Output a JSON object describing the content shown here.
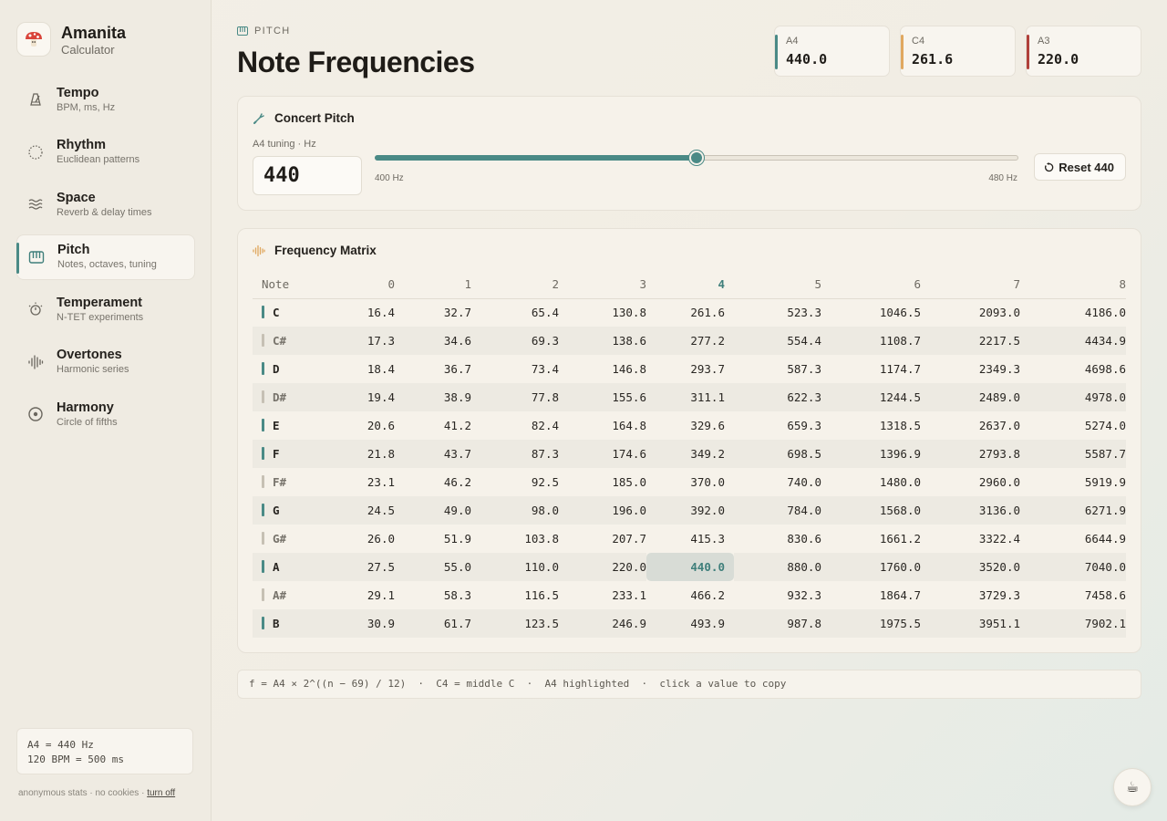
{
  "brand": {
    "name": "Amanita",
    "subtitle": "Calculator"
  },
  "nav": [
    {
      "label": "Tempo",
      "sub": "BPM, ms, Hz",
      "icon": "metronome-icon",
      "active": false
    },
    {
      "label": "Rhythm",
      "sub": "Euclidean patterns",
      "icon": "circle-dotted-icon",
      "active": false
    },
    {
      "label": "Space",
      "sub": "Reverb & delay times",
      "icon": "waves-icon",
      "active": false
    },
    {
      "label": "Pitch",
      "sub": "Notes, octaves, tuning",
      "icon": "piano-icon",
      "active": true
    },
    {
      "label": "Temperament",
      "sub": "N-TET experiments",
      "icon": "sun-dial-icon",
      "active": false
    },
    {
      "label": "Overtones",
      "sub": "Harmonic series",
      "icon": "waveform-icon",
      "active": false
    },
    {
      "label": "Harmony",
      "sub": "Circle of fifths",
      "icon": "target-icon",
      "active": false
    }
  ],
  "side_info": {
    "line1": "A4 = 440 Hz",
    "line2": "120 BPM = 500 ms"
  },
  "footer": {
    "text": "anonymous stats · no cookies · ",
    "link": "turn off"
  },
  "header": {
    "section": "PITCH",
    "title": "Note Frequencies"
  },
  "chips": [
    {
      "note": "A4",
      "value": "440.0",
      "color": "#4a8a86"
    },
    {
      "note": "C4",
      "value": "261.6",
      "color": "#e0a860"
    },
    {
      "note": "A3",
      "value": "220.0",
      "color": "#b0403a"
    }
  ],
  "concert": {
    "title": "Concert Pitch",
    "input_label": "A4 tuning · Hz",
    "value": "440",
    "slider_min": 400,
    "slider_max": 480,
    "slider_value": 440,
    "min_label": "400 Hz",
    "max_label": "480 Hz",
    "reset_label": "Reset 440"
  },
  "matrix": {
    "title": "Frequency Matrix",
    "note_header": "Note",
    "octaves": [
      "0",
      "1",
      "2",
      "3",
      "4",
      "5",
      "6",
      "7",
      "8"
    ],
    "highlight_octave": "4",
    "highlight_note": "A",
    "rows": [
      {
        "note": "C",
        "sharp": false,
        "values": [
          "16.4",
          "32.7",
          "65.4",
          "130.8",
          "261.6",
          "523.3",
          "1046.5",
          "2093.0",
          "4186.0"
        ]
      },
      {
        "note": "C#",
        "sharp": true,
        "values": [
          "17.3",
          "34.6",
          "69.3",
          "138.6",
          "277.2",
          "554.4",
          "1108.7",
          "2217.5",
          "4434.9"
        ]
      },
      {
        "note": "D",
        "sharp": false,
        "values": [
          "18.4",
          "36.7",
          "73.4",
          "146.8",
          "293.7",
          "587.3",
          "1174.7",
          "2349.3",
          "4698.6"
        ]
      },
      {
        "note": "D#",
        "sharp": true,
        "values": [
          "19.4",
          "38.9",
          "77.8",
          "155.6",
          "311.1",
          "622.3",
          "1244.5",
          "2489.0",
          "4978.0"
        ]
      },
      {
        "note": "E",
        "sharp": false,
        "values": [
          "20.6",
          "41.2",
          "82.4",
          "164.8",
          "329.6",
          "659.3",
          "1318.5",
          "2637.0",
          "5274.0"
        ]
      },
      {
        "note": "F",
        "sharp": false,
        "values": [
          "21.8",
          "43.7",
          "87.3",
          "174.6",
          "349.2",
          "698.5",
          "1396.9",
          "2793.8",
          "5587.7"
        ]
      },
      {
        "note": "F#",
        "sharp": true,
        "values": [
          "23.1",
          "46.2",
          "92.5",
          "185.0",
          "370.0",
          "740.0",
          "1480.0",
          "2960.0",
          "5919.9"
        ]
      },
      {
        "note": "G",
        "sharp": false,
        "values": [
          "24.5",
          "49.0",
          "98.0",
          "196.0",
          "392.0",
          "784.0",
          "1568.0",
          "3136.0",
          "6271.9"
        ]
      },
      {
        "note": "G#",
        "sharp": true,
        "values": [
          "26.0",
          "51.9",
          "103.8",
          "207.7",
          "415.3",
          "830.6",
          "1661.2",
          "3322.4",
          "6644.9"
        ]
      },
      {
        "note": "A",
        "sharp": false,
        "values": [
          "27.5",
          "55.0",
          "110.0",
          "220.0",
          "440.0",
          "880.0",
          "1760.0",
          "3520.0",
          "7040.0"
        ]
      },
      {
        "note": "A#",
        "sharp": true,
        "values": [
          "29.1",
          "58.3",
          "116.5",
          "233.1",
          "466.2",
          "932.3",
          "1864.7",
          "3729.3",
          "7458.6"
        ]
      },
      {
        "note": "B",
        "sharp": false,
        "values": [
          "30.9",
          "61.7",
          "123.5",
          "246.9",
          "493.9",
          "987.8",
          "1975.5",
          "3951.1",
          "7902.1"
        ]
      }
    ]
  },
  "formula": "f = A4 × 2^((n − 69) / 12)  ·  C4 = middle C  ·  A4 highlighted  ·  click a value to copy",
  "coffee": {
    "glyph": "☕",
    "icon": "coffee-icon"
  }
}
